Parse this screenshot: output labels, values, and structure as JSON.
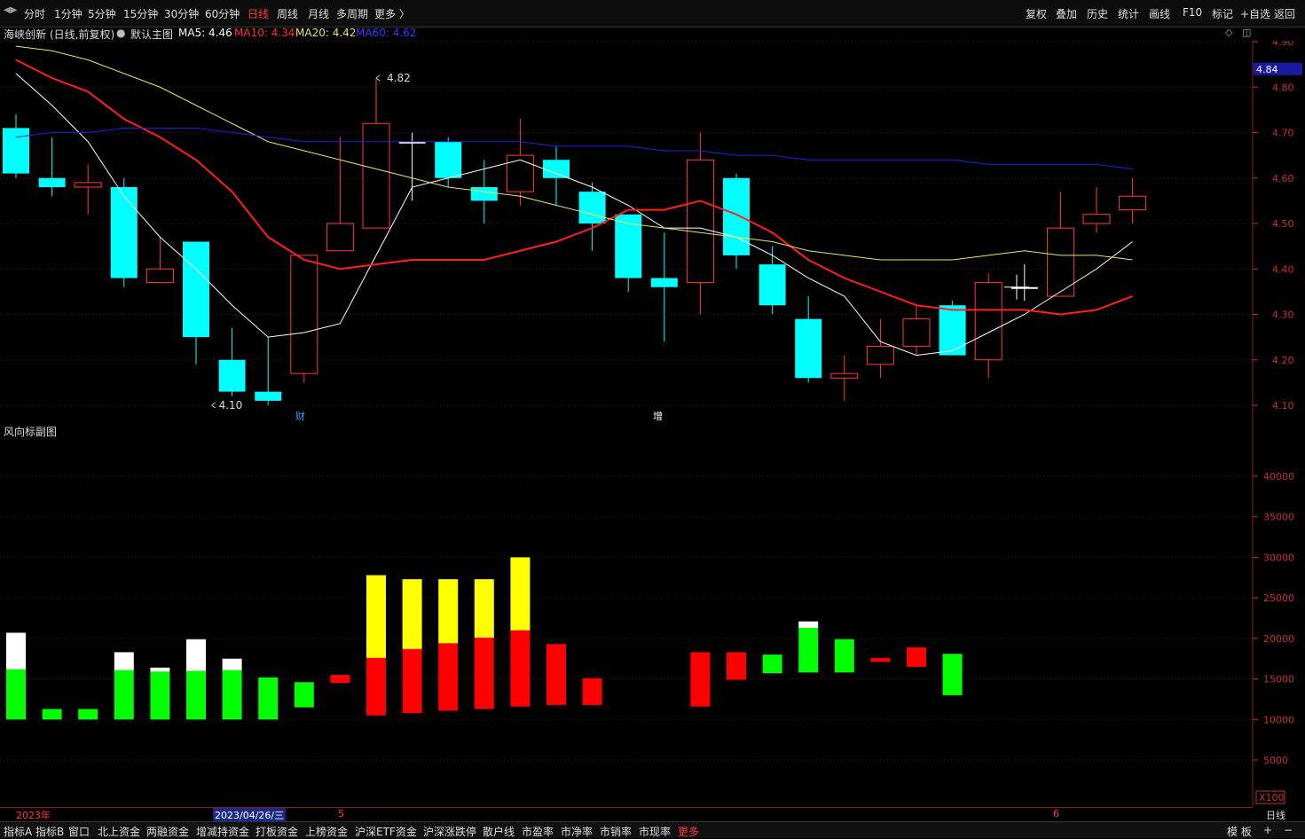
{
  "toolbar": {
    "left_items": [
      "分时",
      "1分钟",
      "5分钟",
      "15分钟",
      "30分钟",
      "60分钟",
      "日线",
      "周线",
      "月线",
      "多周期",
      "更多 〉"
    ],
    "active": "日线",
    "right_items": [
      "复权",
      "叠加",
      "历史",
      "统计",
      "画线",
      "F10",
      "标记",
      "+自选",
      "返回"
    ]
  },
  "info": {
    "stock": "海峡创新",
    "mode": "(日线,前复权)",
    "main_label": "默认主图",
    "ma5": "MA5: 4.46",
    "ma10": "MA10: 4.34",
    "ma20": "MA20: 4.42",
    "ma60": "MA60: 4.62"
  },
  "colors": {
    "up": "#ff3b3b",
    "down": "#00ffff",
    "ma5": "#ffffff",
    "ma10": "#ff2020",
    "ma20": "#e8e860",
    "ma60": "#2222dd",
    "green": "#00ff00",
    "red": "#ff0000",
    "yellow": "#ffff00",
    "white": "#ffffff"
  },
  "price_axis": {
    "ticks": [
      "4.90",
      "4.80",
      "4.70",
      "4.60",
      "4.50",
      "4.40",
      "4.30",
      "4.20",
      "4.10"
    ],
    "current": "4.84"
  },
  "annotations": {
    "high": "4.82",
    "low": "4.10",
    "cai": "财",
    "zeng": "增"
  },
  "sub": {
    "title": "风向标副图",
    "ticks": [
      "40000",
      "35000",
      "30000",
      "25000",
      "20000",
      "15000",
      "10000",
      "5000"
    ],
    "x100": "X100"
  },
  "dates": {
    "year": "2023年",
    "selected": "2023/04/26/三",
    "m5": "5",
    "m6": "6",
    "period": "日线"
  },
  "bottom": {
    "items": [
      "指标A",
      "指标B",
      "窗口",
      "北上资金",
      "两融资金",
      "增减持资金",
      "打板资金",
      "上榜资金",
      "沪深ETF资金",
      "沪深涨跌停",
      "散户线",
      "市盈率",
      "市净率",
      "市销率",
      "市现率",
      "更多"
    ],
    "right_items": [
      "模 板",
      "+",
      "−"
    ]
  },
  "chart_data": [
    {
      "type": "candlestick",
      "title": "海峡创新 (日线,前复权)",
      "ylim": [
        4.07,
        4.92
      ],
      "x_index": [
        0,
        1,
        2,
        3,
        4,
        5,
        6,
        7,
        8,
        9,
        10,
        11,
        12,
        13,
        14,
        15,
        16,
        17,
        18,
        19,
        20,
        21,
        22,
        23,
        24,
        25,
        26,
        27,
        28,
        29,
        30,
        31
      ],
      "candles": [
        {
          "o": 4.71,
          "c": 4.61,
          "h": 4.74,
          "l": 4.6
        },
        {
          "o": 4.6,
          "c": 4.58,
          "h": 4.69,
          "l": 4.56
        },
        {
          "o": 4.58,
          "c": 4.59,
          "h": 4.63,
          "l": 4.52
        },
        {
          "o": 4.58,
          "c": 4.38,
          "h": 4.6,
          "l": 4.36
        },
        {
          "o": 4.37,
          "c": 4.4,
          "h": 4.47,
          "l": 4.37
        },
        {
          "o": 4.46,
          "c": 4.25,
          "h": 4.46,
          "l": 4.19
        },
        {
          "o": 4.2,
          "c": 4.13,
          "h": 4.27,
          "l": 4.12
        },
        {
          "o": 4.13,
          "c": 4.11,
          "h": 4.25,
          "l": 4.1
        },
        {
          "o": 4.17,
          "c": 4.43,
          "h": 4.43,
          "l": 4.15
        },
        {
          "o": 4.44,
          "c": 4.5,
          "h": 4.69,
          "l": 4.44
        },
        {
          "o": 4.49,
          "c": 4.72,
          "h": 4.82,
          "l": 4.49
        },
        {
          "o": 4.68,
          "c": 4.68,
          "h": 4.7,
          "l": 4.55
        },
        {
          "o": 4.68,
          "c": 4.6,
          "h": 4.69,
          "l": 4.58
        },
        {
          "o": 4.58,
          "c": 4.55,
          "h": 4.64,
          "l": 4.5
        },
        {
          "o": 4.57,
          "c": 4.65,
          "h": 4.73,
          "l": 4.54
        },
        {
          "o": 4.64,
          "c": 4.6,
          "h": 4.67,
          "l": 4.54
        },
        {
          "o": 4.57,
          "c": 4.5,
          "h": 4.59,
          "l": 4.44
        },
        {
          "o": 4.52,
          "c": 4.38,
          "h": 4.52,
          "l": 4.35
        },
        {
          "o": 4.38,
          "c": 4.36,
          "h": 4.48,
          "l": 4.24
        },
        {
          "o": 4.37,
          "c": 4.64,
          "h": 4.7,
          "l": 4.3
        },
        {
          "o": 4.6,
          "c": 4.43,
          "h": 4.61,
          "l": 4.4
        },
        {
          "o": 4.41,
          "c": 4.32,
          "h": 4.45,
          "l": 4.3
        },
        {
          "o": 4.29,
          "c": 4.16,
          "h": 4.34,
          "l": 4.15
        },
        {
          "o": 4.16,
          "c": 4.17,
          "h": 4.21,
          "l": 4.11
        },
        {
          "o": 4.19,
          "c": 4.23,
          "h": 4.29,
          "l": 4.16
        },
        {
          "o": 4.23,
          "c": 4.29,
          "h": 4.32,
          "l": 4.21
        },
        {
          "o": 4.32,
          "c": 4.21,
          "h": 4.33,
          "l": 4.21
        },
        {
          "o": 4.2,
          "c": 4.37,
          "h": 4.39,
          "l": 4.16
        },
        {
          "o": 4.36,
          "c": 4.36,
          "h": 4.41,
          "l": 4.33
        },
        {
          "o": 4.34,
          "c": 4.49,
          "h": 4.57,
          "l": 4.34
        },
        {
          "o": 4.5,
          "c": 4.52,
          "h": 4.58,
          "l": 4.48
        },
        {
          "o": 4.53,
          "c": 4.56,
          "h": 4.6,
          "l": 4.5
        }
      ],
      "ma_lines": {
        "MA5": [
          4.83,
          4.76,
          4.68,
          4.56,
          4.47,
          4.4,
          4.32,
          4.25,
          4.26,
          4.28,
          4.43,
          4.58,
          4.6,
          4.62,
          4.64,
          4.61,
          4.58,
          4.54,
          4.49,
          4.49,
          4.47,
          4.43,
          4.38,
          4.34,
          4.24,
          4.21,
          4.22,
          4.26,
          4.3,
          4.35,
          4.4,
          4.46
        ],
        "MA10": [
          4.86,
          4.82,
          4.79,
          4.73,
          4.69,
          4.64,
          4.57,
          4.47,
          4.42,
          4.4,
          4.41,
          4.42,
          4.42,
          4.42,
          4.44,
          4.46,
          4.49,
          4.53,
          4.53,
          4.55,
          4.52,
          4.48,
          4.42,
          4.38,
          4.35,
          4.32,
          4.31,
          4.31,
          4.31,
          4.3,
          4.31,
          4.34
        ],
        "MA20": [
          4.89,
          4.88,
          4.86,
          4.83,
          4.8,
          4.76,
          4.72,
          4.68,
          4.66,
          4.64,
          4.62,
          4.6,
          4.58,
          4.57,
          4.56,
          4.54,
          4.52,
          4.5,
          4.49,
          4.48,
          4.47,
          4.46,
          4.44,
          4.43,
          4.42,
          4.42,
          4.42,
          4.43,
          4.44,
          4.43,
          4.43,
          4.42
        ],
        "MA60": [
          4.69,
          4.7,
          4.7,
          4.71,
          4.71,
          4.71,
          4.7,
          4.69,
          4.68,
          4.68,
          4.68,
          4.68,
          4.68,
          4.68,
          4.68,
          4.67,
          4.67,
          4.67,
          4.66,
          4.66,
          4.65,
          4.65,
          4.64,
          4.64,
          4.64,
          4.64,
          4.64,
          4.63,
          4.63,
          4.63,
          4.63,
          4.62
        ]
      }
    },
    {
      "type": "bar",
      "title": "风向标副图",
      "ylim": [
        0,
        47000
      ],
      "bars": [
        {
          "i": 0,
          "segments": [
            {
              "color": "green",
              "from": 10000,
              "to": 16200
            },
            {
              "color": "white",
              "from": 16200,
              "to": 20700
            }
          ]
        },
        {
          "i": 1,
          "segments": [
            {
              "color": "green",
              "from": 10000,
              "to": 11300
            }
          ]
        },
        {
          "i": 2,
          "segments": [
            {
              "color": "green",
              "from": 10000,
              "to": 11300
            }
          ]
        },
        {
          "i": 3,
          "segments": [
            {
              "color": "green",
              "from": 10000,
              "to": 16100
            },
            {
              "color": "white",
              "from": 16100,
              "to": 18300
            }
          ]
        },
        {
          "i": 4,
          "segments": [
            {
              "color": "green",
              "from": 10000,
              "to": 15900
            },
            {
              "color": "white",
              "from": 15900,
              "to": 16400
            }
          ]
        },
        {
          "i": 5,
          "segments": [
            {
              "color": "green",
              "from": 10000,
              "to": 16000
            },
            {
              "color": "white",
              "from": 16000,
              "to": 19900
            }
          ]
        },
        {
          "i": 6,
          "segments": [
            {
              "color": "green",
              "from": 10000,
              "to": 16100
            },
            {
              "color": "white",
              "from": 16100,
              "to": 17500
            }
          ]
        },
        {
          "i": 7,
          "segments": [
            {
              "color": "green",
              "from": 10000,
              "to": 15200
            }
          ]
        },
        {
          "i": 8,
          "segments": [
            {
              "color": "green",
              "from": 11500,
              "to": 14600
            }
          ]
        },
        {
          "i": 9,
          "segments": [
            {
              "color": "red",
              "from": 14500,
              "to": 15500
            }
          ]
        },
        {
          "i": 10,
          "segments": [
            {
              "color": "red",
              "from": 10500,
              "to": 17600
            },
            {
              "color": "yellow",
              "from": 17600,
              "to": 27800
            }
          ]
        },
        {
          "i": 11,
          "segments": [
            {
              "color": "red",
              "from": 10800,
              "to": 18700
            },
            {
              "color": "yellow",
              "from": 18700,
              "to": 27300
            }
          ]
        },
        {
          "i": 12,
          "segments": [
            {
              "color": "red",
              "from": 11100,
              "to": 19400
            },
            {
              "color": "yellow",
              "from": 19400,
              "to": 27300
            }
          ]
        },
        {
          "i": 13,
          "segments": [
            {
              "color": "red",
              "from": 11300,
              "to": 20100
            },
            {
              "color": "yellow",
              "from": 20100,
              "to": 27300
            }
          ]
        },
        {
          "i": 14,
          "segments": [
            {
              "color": "red",
              "from": 11600,
              "to": 21000
            },
            {
              "color": "yellow",
              "from": 21000,
              "to": 30000
            }
          ]
        },
        {
          "i": 15,
          "segments": [
            {
              "color": "red",
              "from": 11800,
              "to": 19300
            }
          ]
        },
        {
          "i": 16,
          "segments": [
            {
              "color": "red",
              "from": 11800,
              "to": 15100
            }
          ]
        },
        {
          "i": 19,
          "segments": [
            {
              "color": "red",
              "from": 11600,
              "to": 18300
            }
          ]
        },
        {
          "i": 20,
          "segments": [
            {
              "color": "red",
              "from": 14900,
              "to": 18300
            }
          ]
        },
        {
          "i": 21,
          "segments": [
            {
              "color": "green",
              "from": 15700,
              "to": 18000
            }
          ]
        },
        {
          "i": 22,
          "segments": [
            {
              "color": "green",
              "from": 15800,
              "to": 21300
            },
            {
              "color": "white",
              "from": 21300,
              "to": 22100
            }
          ]
        },
        {
          "i": 23,
          "segments": [
            {
              "color": "green",
              "from": 15800,
              "to": 19900
            }
          ]
        },
        {
          "i": 24,
          "segments": [
            {
              "color": "red",
              "from": 17100,
              "to": 17600
            }
          ]
        },
        {
          "i": 25,
          "segments": [
            {
              "color": "red",
              "from": 16500,
              "to": 18900
            }
          ]
        },
        {
          "i": 26,
          "segments": [
            {
              "color": "green",
              "from": 13000,
              "to": 18100
            }
          ]
        }
      ]
    }
  ]
}
